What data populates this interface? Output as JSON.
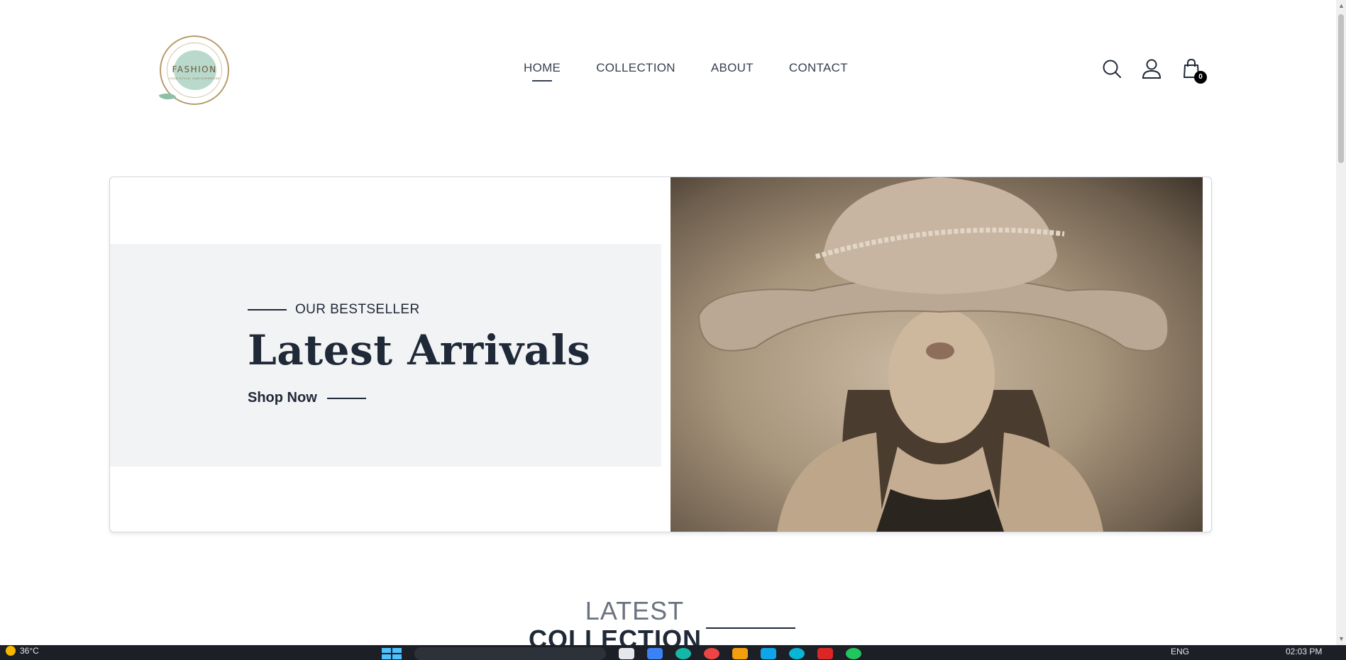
{
  "logo": {
    "word": "FASHION",
    "tagline": "YOUR STYLE, OUR EXPERTISE"
  },
  "nav": {
    "items": [
      "HOME",
      "COLLECTION",
      "ABOUT",
      "CONTACT"
    ],
    "active": "HOME"
  },
  "header_icons": {
    "search": "search-icon",
    "profile": "user-icon",
    "cart": "shopping-bag-icon",
    "cart_count": "0"
  },
  "hero": {
    "eyebrow": "OUR BESTSELLER",
    "title": "Latest Arrivals",
    "cta": "Shop Now",
    "image": "woman-in-wide-brim-hat-photo"
  },
  "section": {
    "title_line1": "LATEST",
    "title_line2": "COLLECTION"
  },
  "taskbar": {
    "weather": "36°C",
    "lang": "ENG",
    "time": "02:03 PM"
  },
  "colors": {
    "text_dark": "#1f2937",
    "hero_panel": "#f2f3f5",
    "logo_mint": "#b8d9cc",
    "logo_gold": "#b89a6a"
  }
}
